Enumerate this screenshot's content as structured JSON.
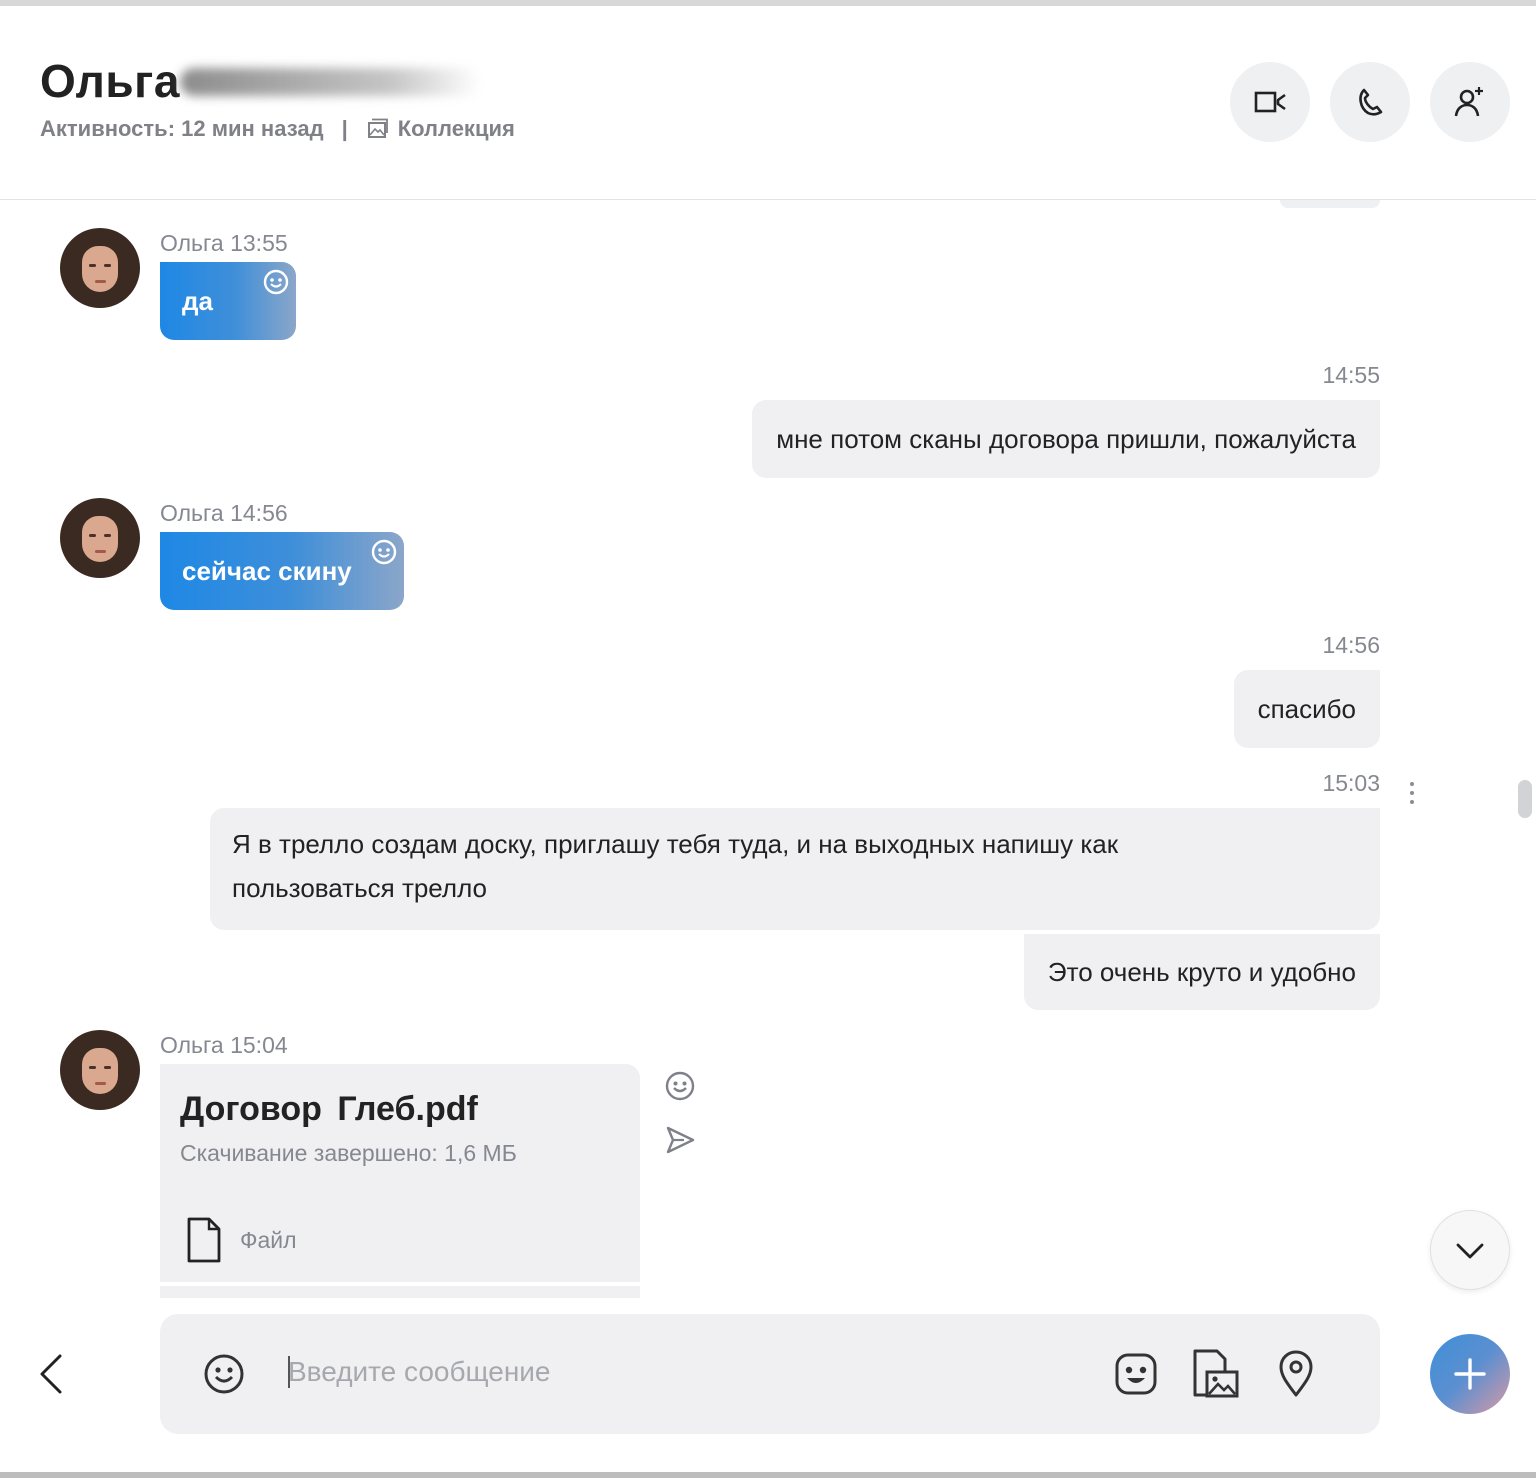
{
  "header": {
    "contact_name": "Ольга",
    "activity": "Активность: 12 мин назад",
    "separator": "|",
    "collection_label": "Коллекция",
    "actions": [
      "video-call",
      "audio-call",
      "add-person"
    ]
  },
  "messages": [
    {
      "dir": "in",
      "author": "Ольга",
      "time": "13:55",
      "meta": "Ольга 13:55",
      "text": "да"
    },
    {
      "dir": "out",
      "time": "14:55",
      "text": "мне потом сканы договора пришли, пожалуйста"
    },
    {
      "dir": "in",
      "author": "Ольга",
      "time": "14:56",
      "meta": "Ольга 14:56",
      "text": "сейчас скину"
    },
    {
      "dir": "out",
      "time": "14:56",
      "text": "спасибо"
    },
    {
      "dir": "out",
      "time": "15:03",
      "text_line1": "Я в трелло создам доску, приглашу тебя туда, и на выходных напишу как",
      "text_line2": "пользоваться трелло"
    },
    {
      "dir": "out",
      "text": "Это очень круто и удобно"
    },
    {
      "dir": "in",
      "author": "Ольга",
      "time": "15:04",
      "meta": "Ольга 15:04",
      "file": {
        "name": "Договор Глеб.pdf",
        "status": "Скачивание завершено: 1,6 МБ",
        "type_label": "Файл"
      }
    }
  ],
  "composer": {
    "placeholder": "Введите сообщение",
    "value": "",
    "tools": [
      "emoji-icon",
      "sticker-icon",
      "media-icon",
      "location-icon"
    ]
  },
  "colors": {
    "incoming_start": "#1e88e5",
    "incoming_end": "#8ba6c9",
    "outgoing_bg": "#f0f0f2",
    "meta_text": "#858891",
    "plus_start": "#3f8fd9",
    "plus_end": "#d89aa5"
  }
}
